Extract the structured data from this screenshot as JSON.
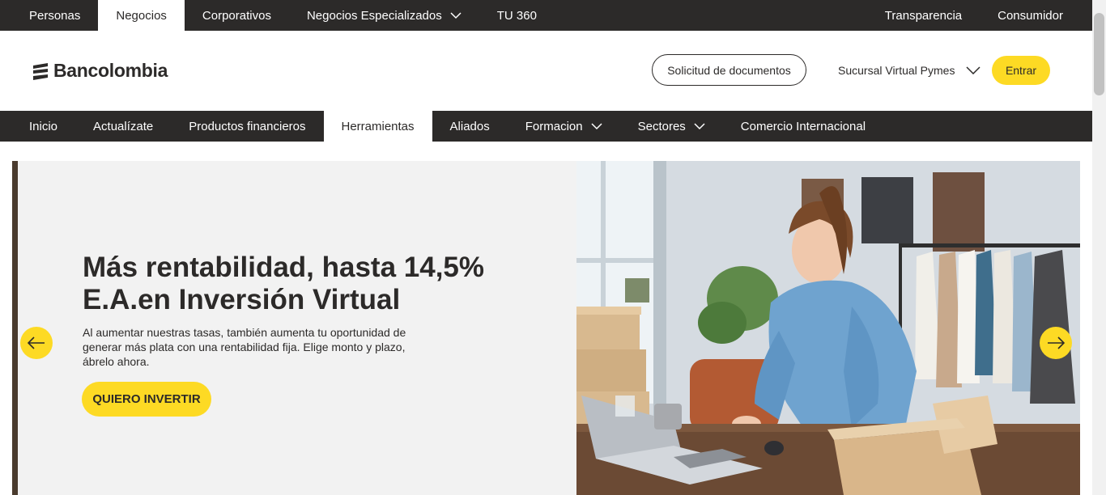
{
  "topbar": {
    "left_links": [
      {
        "label": "Personas",
        "active": false
      },
      {
        "label": "Negocios",
        "active": true
      },
      {
        "label": "Corporativos",
        "active": false
      },
      {
        "label": "Negocios Especializados",
        "active": false,
        "dropdown": true
      },
      {
        "label": "TU 360",
        "active": false
      }
    ],
    "right_links": [
      {
        "label": "Transparencia"
      },
      {
        "label": "Consumidor"
      }
    ]
  },
  "header": {
    "logo_text": "Bancolombia",
    "documents_button": "Solicitud de documentos",
    "sucursal_label": "Sucursal Virtual Pymes",
    "login_button": "Entrar"
  },
  "mainnav": {
    "items": [
      {
        "label": "Inicio",
        "active": false
      },
      {
        "label": "Actualízate",
        "active": false
      },
      {
        "label": "Productos financieros",
        "active": false
      },
      {
        "label": "Herramientas",
        "active": true
      },
      {
        "label": "Aliados",
        "active": false
      },
      {
        "label": "Formacion",
        "active": false,
        "dropdown": true
      },
      {
        "label": "Sectores",
        "active": false,
        "dropdown": true
      },
      {
        "label": "Comercio Internacional",
        "active": false
      }
    ]
  },
  "hero": {
    "title": "Más rentabilidad, hasta 14,5% E.A.en Inversión Virtual",
    "description": "Al aumentar nuestras tasas, también aumenta tu oportunidad de generar más plata con una rentabilidad fija. Elige monto y plazo, ábrelo ahora.",
    "cta_label": "QUIERO INVERTIR",
    "prev_icon": "arrow-left-icon",
    "next_icon": "arrow-right-icon"
  },
  "colors": {
    "dark": "#2c2a29",
    "yellow": "#fdda24",
    "panel": "#f2f2f2"
  }
}
